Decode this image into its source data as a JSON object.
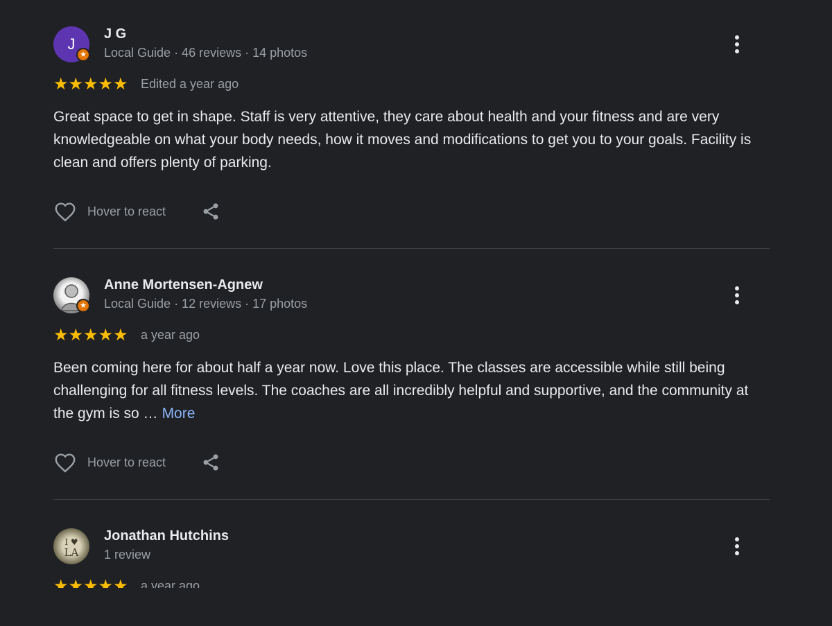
{
  "reviews": [
    {
      "avatar_letter": "J",
      "name": "J G",
      "meta": "Local Guide · 46 reviews · 14 photos",
      "stars": "★★★★★",
      "rating": 5,
      "time": "Edited a year ago",
      "text": "Great space to get in shape. Staff is very attentive, they care about health and your fitness and are very knowledgeable on what your body needs, how it moves and modifications to get you to your goals. Facility is clean and offers plenty of parking.",
      "react_label": "Hover to react"
    },
    {
      "name": "Anne Mortensen-Agnew",
      "meta": "Local Guide · 12 reviews · 17 photos",
      "stars": "★★★★★",
      "rating": 5,
      "time": "a year ago",
      "text": "Been coming here for about half a year now. Love this place. The classes are accessible while still being challenging for all fitness levels. The coaches are all incredibly helpful and supportive, and the community at the gym is so …",
      "more_label": "More",
      "react_label": "Hover to react"
    },
    {
      "name": "Jonathan Hutchins",
      "meta": "1 review",
      "stars": "★★★★★",
      "rating": 5,
      "time": "a year ago"
    }
  ],
  "colors": {
    "background": "#202124",
    "star": "#fbbc04",
    "link": "#8ab4f8",
    "local_guide_badge": "#e37400",
    "avatar_jg": "#5e35b1"
  },
  "icons": [
    "local-guide-badge-icon",
    "more-options-icon",
    "heart-icon",
    "share-icon"
  ]
}
